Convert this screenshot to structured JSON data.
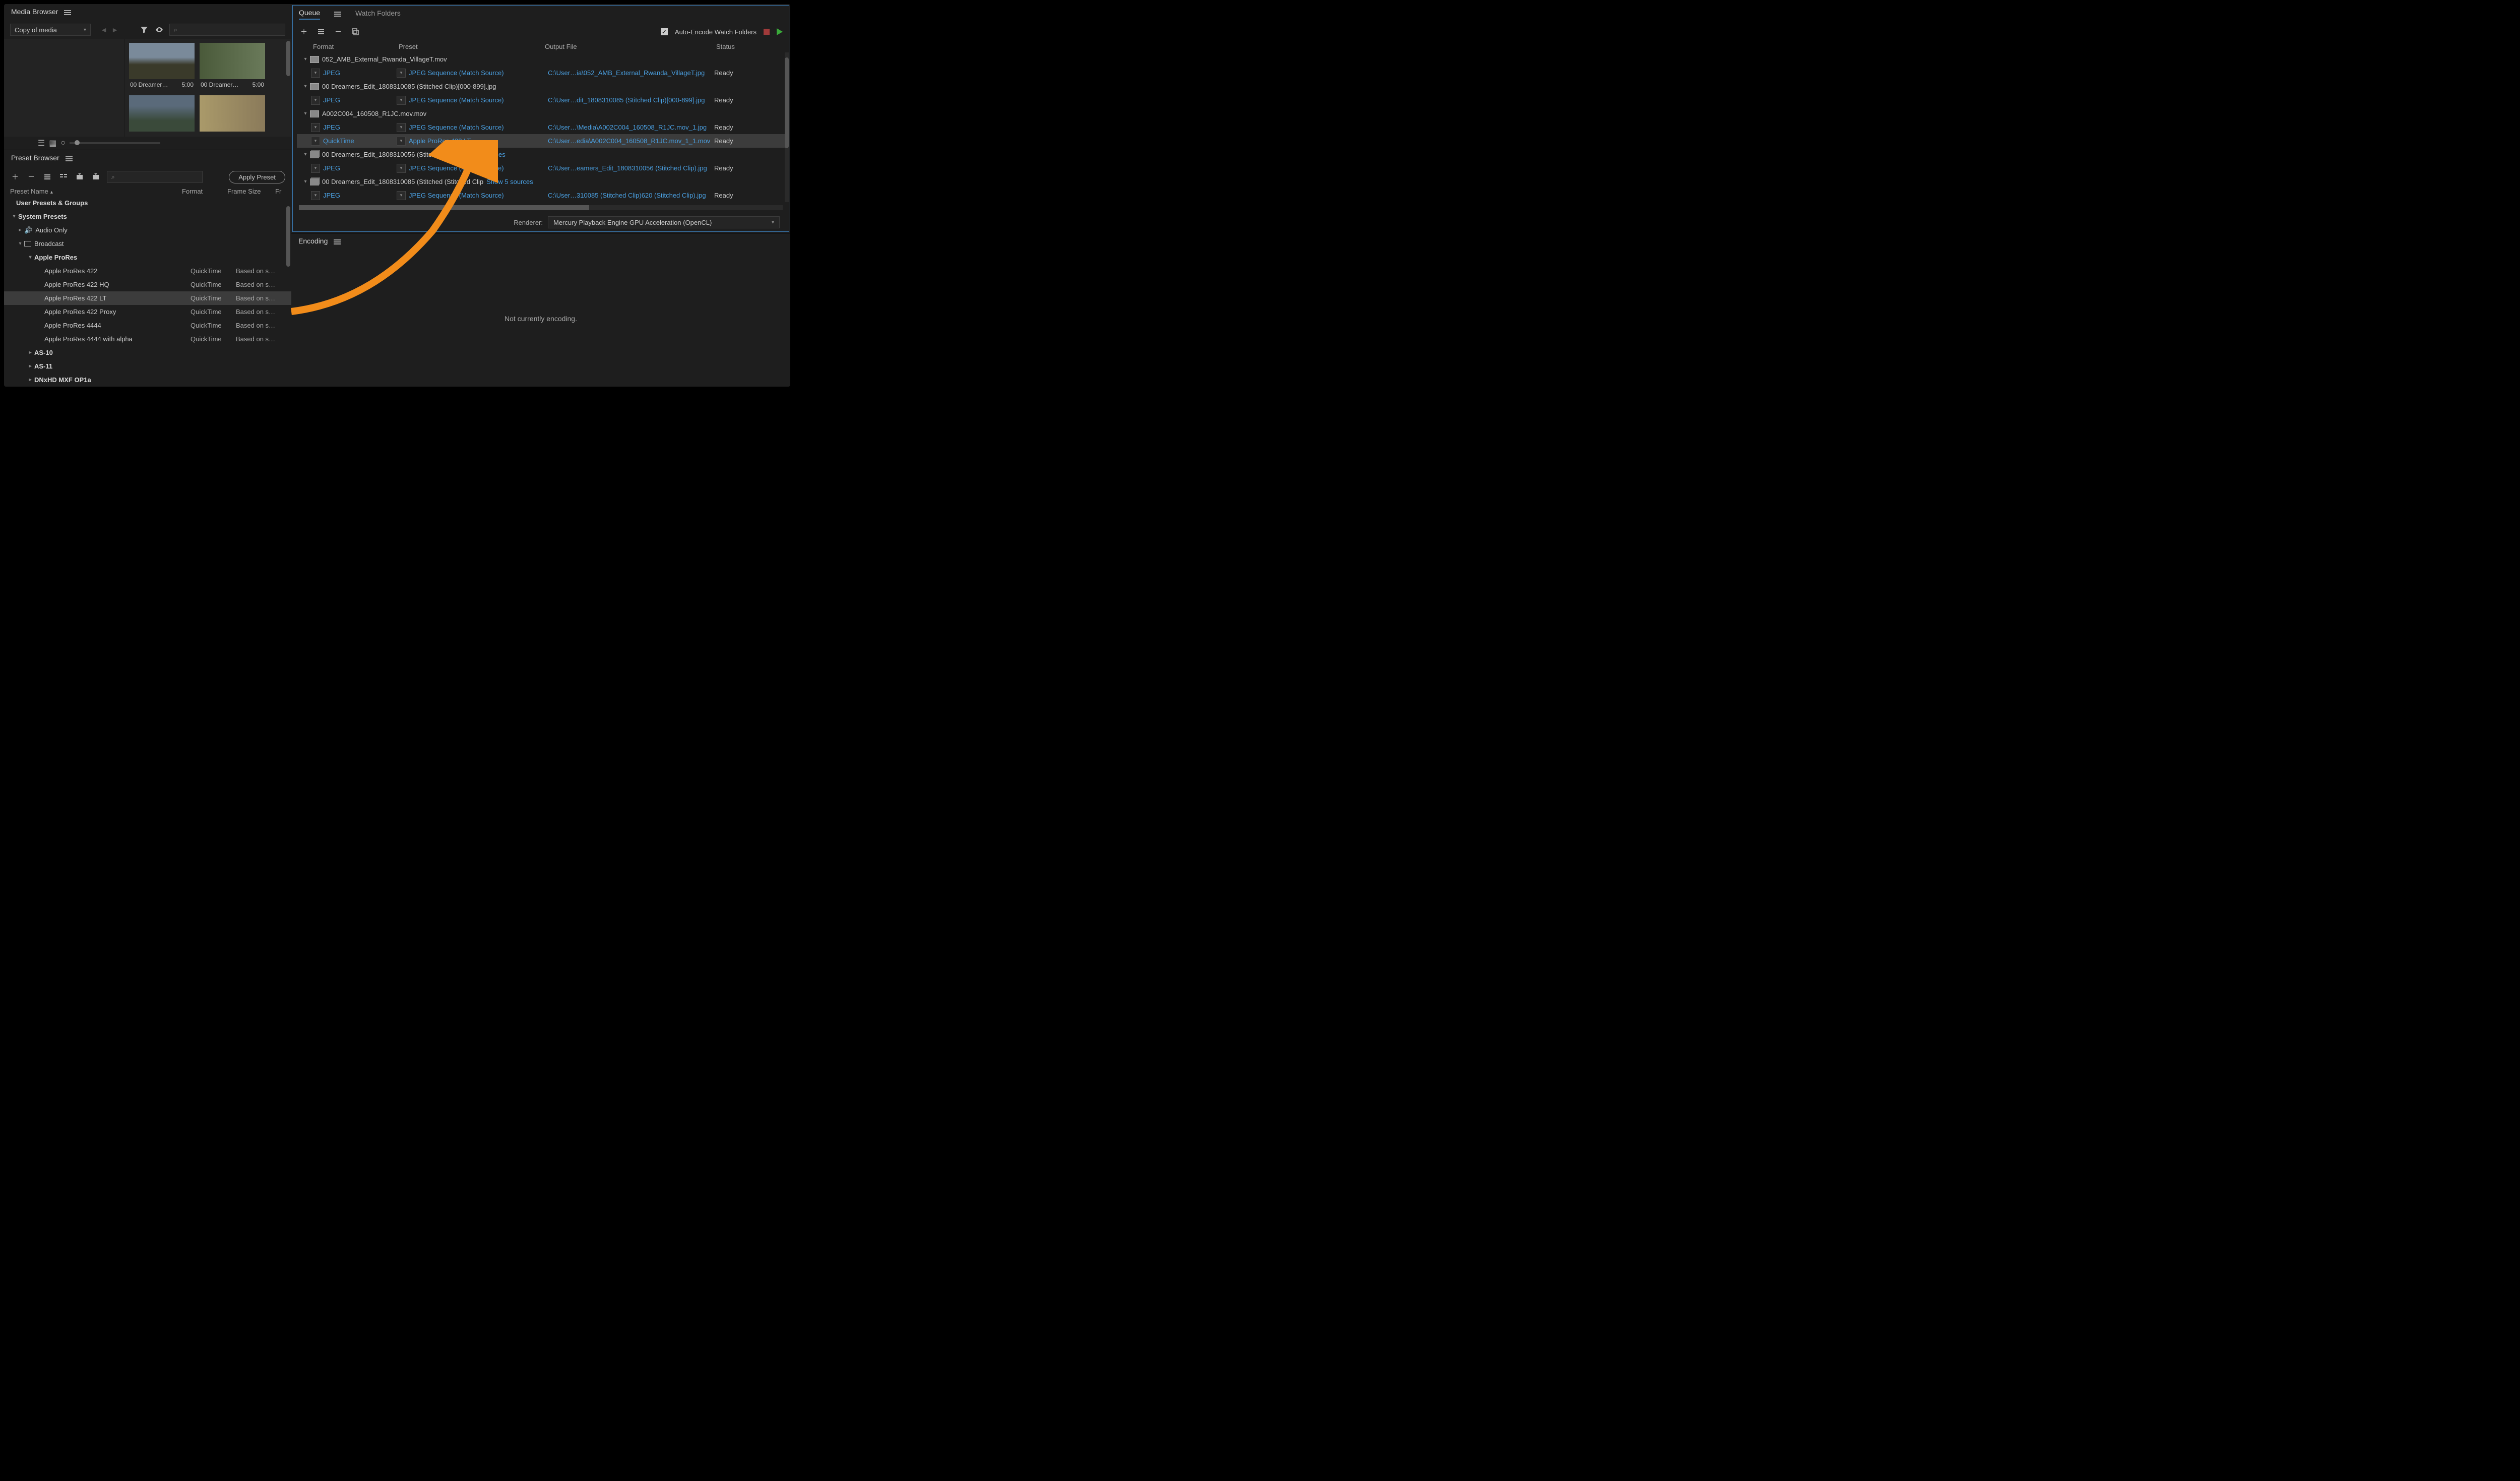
{
  "mediaBrowser": {
    "title": "Media Browser",
    "dropdown": "Copy of media",
    "thumbs": [
      {
        "name": "00 Dreamer…",
        "dur": "5:00"
      },
      {
        "name": "00 Dreamer…",
        "dur": "5:00"
      }
    ]
  },
  "presetBrowser": {
    "title": "Preset Browser",
    "applyLabel": "Apply Preset",
    "cols": {
      "name": "Preset Name",
      "format": "Format",
      "size": "Frame Size",
      "fr": "Fr"
    },
    "userPresets": "User Presets & Groups",
    "systemPresets": "System Presets",
    "groups": {
      "audio": "Audio Only",
      "broadcast": "Broadcast",
      "apple": "Apple ProRes",
      "as10": "AS-10",
      "as11": "AS-11",
      "dnxhd": "DNxHD MXF OP1a"
    },
    "presets": [
      {
        "name": "Apple ProRes 422",
        "fmt": "QuickTime",
        "size": "Based on s…"
      },
      {
        "name": "Apple ProRes 422 HQ",
        "fmt": "QuickTime",
        "size": "Based on s…"
      },
      {
        "name": "Apple ProRes 422 LT",
        "fmt": "QuickTime",
        "size": "Based on s…"
      },
      {
        "name": "Apple ProRes 422 Proxy",
        "fmt": "QuickTime",
        "size": "Based on s…"
      },
      {
        "name": "Apple ProRes 4444",
        "fmt": "QuickTime",
        "size": "Based on s…"
      },
      {
        "name": "Apple ProRes 4444 with alpha",
        "fmt": "QuickTime",
        "size": "Based on s…"
      }
    ]
  },
  "queue": {
    "tabQueue": "Queue",
    "tabWatch": "Watch Folders",
    "autoEncode": "Auto-Encode Watch Folders",
    "cols": {
      "format": "Format",
      "preset": "Preset",
      "output": "Output File",
      "status": "Status"
    },
    "rendererLabel": "Renderer:",
    "rendererValue": "Mercury Playback Engine GPU Acceleration (OpenCL)",
    "items": [
      {
        "type": "src",
        "icon": "mov",
        "name": "052_AMB_External_Rwanda_VillageT.mov"
      },
      {
        "type": "enc",
        "fmt": "JPEG",
        "preset": "JPEG Sequence (Match Source)",
        "out": "C:\\User…ia\\052_AMB_External_Rwanda_VillageT.jpg",
        "stat": "Ready"
      },
      {
        "type": "src",
        "icon": "img",
        "name": "00 Dreamers_Edit_1808310085 (Stitched Clip)[000-899].jpg"
      },
      {
        "type": "enc",
        "fmt": "JPEG",
        "preset": "JPEG Sequence (Match Source)",
        "out": "C:\\User…dit_1808310085 (Stitched Clip)[000-899].jpg",
        "stat": "Ready"
      },
      {
        "type": "src",
        "icon": "mov",
        "name": "A002C004_160508_R1JC.mov.mov"
      },
      {
        "type": "enc",
        "fmt": "JPEG",
        "preset": "JPEG Sequence (Match Source)",
        "out": "C:\\User…\\Media\\A002C004_160508_R1JC.mov_1.jpg",
        "stat": "Ready"
      },
      {
        "type": "enc",
        "sel": true,
        "fmt": "QuickTime",
        "preset": "Apple ProRes 422 LT",
        "out": "C:\\User…edia\\A002C004_160508_R1JC.mov_1_1.mov",
        "stat": "Ready"
      },
      {
        "type": "src",
        "icon": "stack",
        "name": "00 Dreamers_Edit_1808310056 (Stitched Clip",
        "show": "Show 3 sources"
      },
      {
        "type": "enc",
        "fmt": "JPEG",
        "preset": "JPEG Sequence (Match Source)",
        "out": "C:\\User…eamers_Edit_1808310056 (Stitched Clip).jpg",
        "stat": "Ready"
      },
      {
        "type": "src",
        "icon": "stack",
        "name": "00 Dreamers_Edit_1808310085 (Stitched             (Stitched Clip",
        "show": "Show 5 sources"
      },
      {
        "type": "enc",
        "fmt": "JPEG",
        "preset": "JPEG Sequence (Match Source)",
        "out": "C:\\User…310085 (Stitched Clip)620 (Stitched Clip).jpg",
        "stat": "Ready"
      }
    ]
  },
  "encoding": {
    "title": "Encoding",
    "status": "Not currently encoding."
  }
}
